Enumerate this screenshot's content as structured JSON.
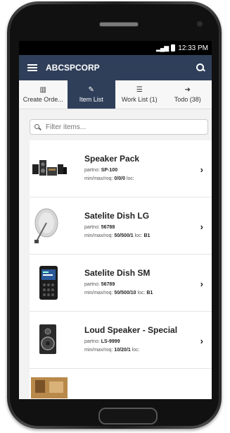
{
  "status_bar": {
    "signal": "▂▄▆",
    "time": "12:33 PM"
  },
  "app_bar": {
    "title": "ABCSPCORP"
  },
  "tabs": [
    {
      "label": "Create Orde...",
      "icon": "▥",
      "active": false
    },
    {
      "label": "Item List",
      "icon": "✎",
      "active": true
    },
    {
      "label": "Work List (1)",
      "icon": "☰",
      "active": false
    },
    {
      "label": "Todo (38)",
      "icon": "➜",
      "active": false
    }
  ],
  "filter": {
    "placeholder": "Filter items..."
  },
  "items": [
    {
      "name": "Speaker Pack",
      "partno_label": "partno:",
      "partno": "SP-100",
      "mmr_label": "min/max/roq:",
      "mmr": "0/0/0",
      "loc_label": "loc:",
      "loc": ""
    },
    {
      "name": "Satelite Dish LG",
      "partno_label": "partno:",
      "partno": "56788",
      "mmr_label": "min/max/roq:",
      "mmr": "50/500/1",
      "loc_label": "loc:",
      "loc": "B1"
    },
    {
      "name": "Satelite Dish SM",
      "partno_label": "partno:",
      "partno": "56789",
      "mmr_label": "min/max/roq:",
      "mmr": "50/500/10",
      "loc_label": "loc:",
      "loc": "B1"
    },
    {
      "name": "Loud Speaker - Special",
      "partno_label": "partno:",
      "partno": "LS-9999",
      "mmr_label": "min/max/roq:",
      "mmr": "10/20/1",
      "loc_label": "loc:",
      "loc": ""
    }
  ],
  "chevron": "›"
}
